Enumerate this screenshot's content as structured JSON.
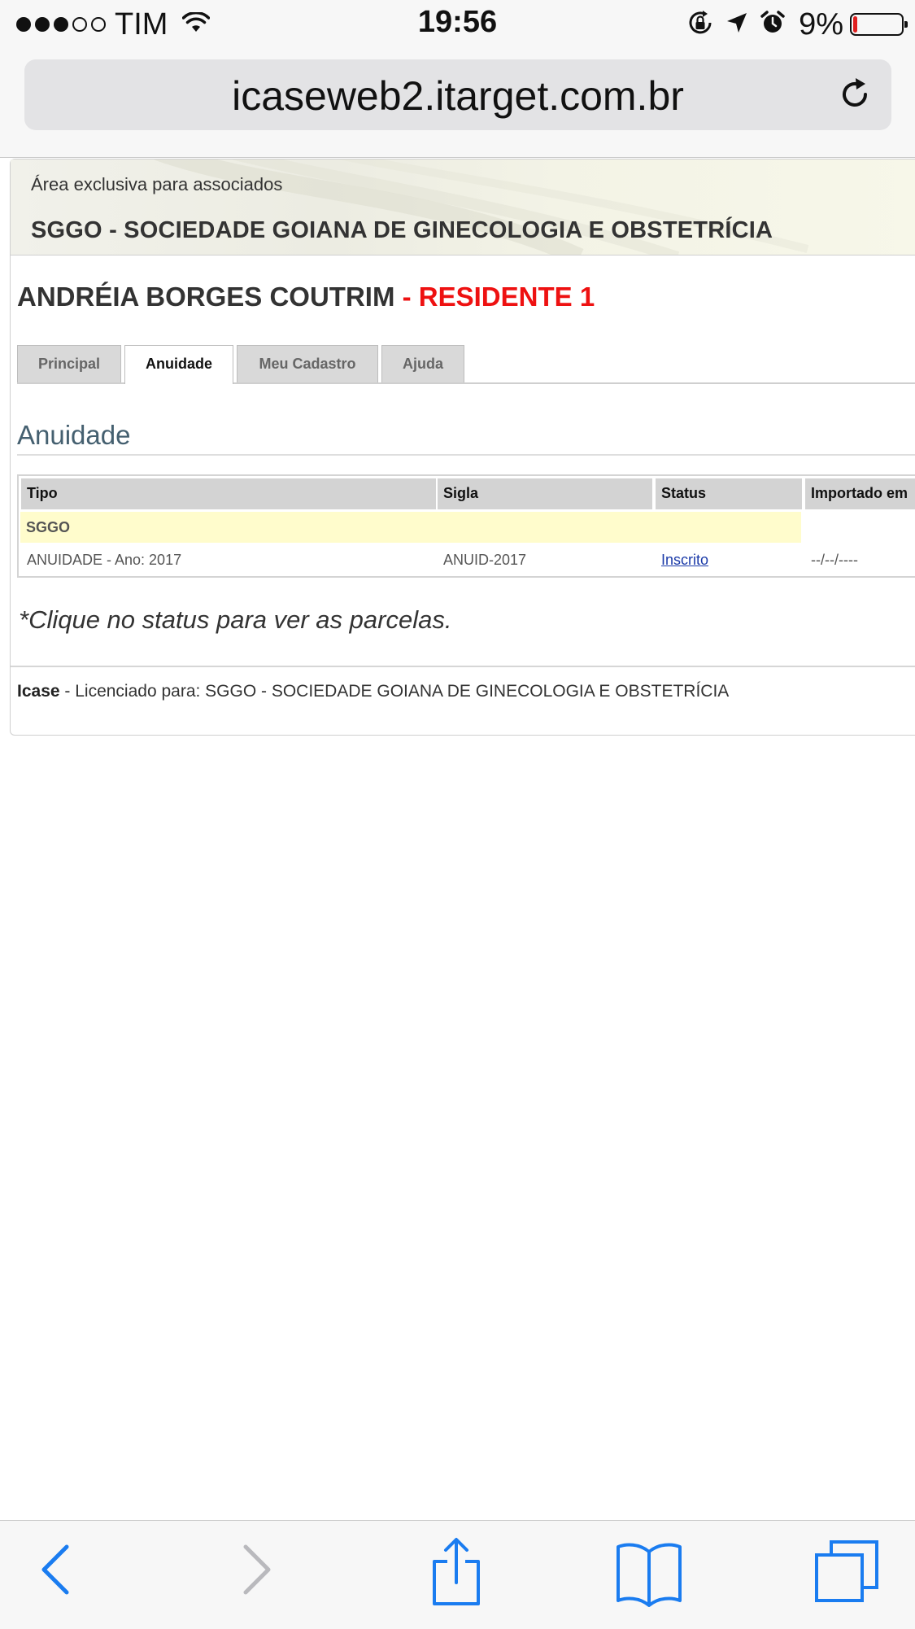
{
  "status_bar": {
    "carrier": "TIM",
    "time": "19:56",
    "battery_percent": "9%",
    "battery_level": 0.09,
    "signal_bars_filled": 3,
    "signal_bars_total": 5
  },
  "browser": {
    "url": "icaseweb2.itarget.com.br"
  },
  "banner": {
    "subtitle": "Área exclusiva para associados",
    "title": "SGGO - SOCIEDADE GOIANA DE GINECOLOGIA E OBSTETRÍCIA"
  },
  "member": {
    "name": "ANDRÉIA BORGES COUTRIM",
    "category": "- RESIDENTE 1"
  },
  "tabs": [
    {
      "label": "Principal",
      "active": false
    },
    {
      "label": "Anuidade",
      "active": true
    },
    {
      "label": "Meu Cadastro",
      "active": false
    },
    {
      "label": "Ajuda",
      "active": false
    }
  ],
  "section": {
    "title": "Anuidade"
  },
  "table": {
    "headers": [
      "Tipo",
      "Sigla",
      "Status",
      "Importado em"
    ],
    "group": "SGGO",
    "rows": [
      {
        "tipo": "ANUIDADE - Ano: 2017",
        "sigla": "ANUID-2017",
        "status": "Inscrito",
        "importado": "--/--/----"
      }
    ]
  },
  "note": "*Clique no status para ver as parcelas.",
  "footer": {
    "brand": "Icase",
    "text": " - Licenciado para: SGGO - SOCIEDADE GOIANA DE GINECOLOGIA E OBSTETRÍCIA"
  },
  "colors": {
    "accent_blue": "#1a7cf0",
    "category_red": "#ee1111",
    "section_title": "#456070",
    "group_row_bg": "#fffccc"
  },
  "toolbar_icons": [
    "back-icon",
    "forward-icon",
    "share-icon",
    "bookmarks-icon",
    "tabs-icon"
  ]
}
